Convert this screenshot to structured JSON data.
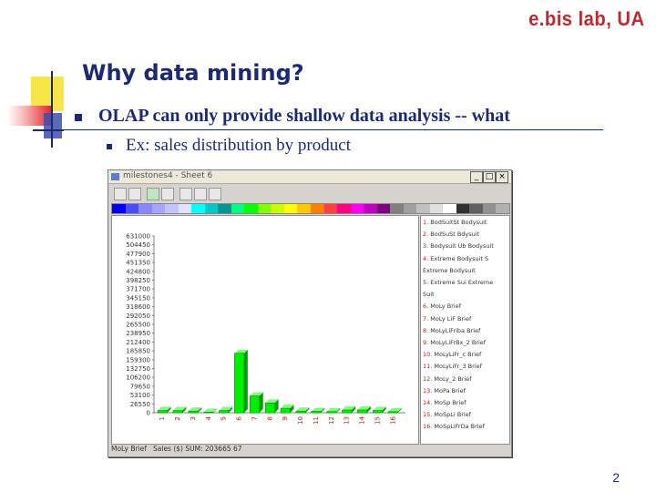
{
  "brand": "e.bis lab, UA",
  "slide_title": "Why data mining?",
  "bullet1": "OLAP can only provide shallow data analysis -- what",
  "bullet2": "Ex: sales distribution by product",
  "page_number": "2",
  "window": {
    "title": "milestones4 - Sheet 6",
    "min_label": "_",
    "max_label": "□",
    "close_label": "×",
    "toolbar_icons": [
      "open-icon",
      "save-icon",
      "chart-icon",
      "table-icon",
      "grid-icon",
      "tools-icon",
      "spell-icon"
    ],
    "status_left": "MoLy Brief",
    "status_right": "Sales ($) SUM: 203665 67"
  },
  "palette": [
    "#0000ff",
    "#4b4bff",
    "#8787ff",
    "#a5a5ff",
    "#c3c3ff",
    "#e1e1ff",
    "#00ffff",
    "#00c8c8",
    "#009696",
    "#00ff80",
    "#00ff00",
    "#80ff00",
    "#c8ff00",
    "#ffff00",
    "#ffc800",
    "#ff8000",
    "#ff4040",
    "#ff0080",
    "#ff00ff",
    "#c000c0",
    "#800080",
    "#808080",
    "#a0a0a0",
    "#c0c0c0",
    "#e0e0e0",
    "#ffffff",
    "#303030",
    "#606060",
    "#909090",
    "#b0b0b0"
  ],
  "chart_data": {
    "type": "bar",
    "categories": [
      "1",
      "2",
      "3",
      "4",
      "5",
      "6",
      "7",
      "8",
      "9",
      "10",
      "11",
      "12",
      "13",
      "14",
      "15",
      "16"
    ],
    "values": [
      8000,
      8000,
      6000,
      2000,
      8000,
      212400,
      60000,
      35000,
      16000,
      6000,
      5000,
      4000,
      10000,
      10000,
      8000,
      4000
    ],
    "y_ticks": [
      "631000",
      "504450",
      "477900",
      "451350",
      "424800",
      "398250",
      "371700",
      "345150",
      "318600",
      "292050",
      "265500",
      "238950",
      "212400",
      "185850",
      "159300",
      "132750",
      "106200",
      "79650",
      "53100",
      "26550",
      "0"
    ],
    "ylim": [
      0,
      631000
    ],
    "colors": {
      "bar_front": "#00ee00",
      "bar_side": "#009c00",
      "bar_top": "#7dff7d",
      "axis": "#808080",
      "tick_label": "#b02020"
    },
    "legend": [
      {
        "num": "1.",
        "label": "BodSuitSt Bodysuit"
      },
      {
        "num": "2.",
        "label": "BodSuSt Bdysuit"
      },
      {
        "num": "3.",
        "label": "Bodysuit Ub Bodysuit"
      },
      {
        "num": "4.",
        "label": "Extreme Bodysuit S"
      },
      {
        "num": "",
        "label": "Extreme Bodysuit"
      },
      {
        "num": "5.",
        "label": "Extreme Sui Extreme"
      },
      {
        "num": "",
        "label": "Suit"
      },
      {
        "num": "6.",
        "label": "MoLy Brief"
      },
      {
        "num": "7.",
        "label": "MoLy LiF Brief"
      },
      {
        "num": "8.",
        "label": "MoLyLiFriba Brief"
      },
      {
        "num": "9.",
        "label": "MoLyLiFrBx_2 Brief"
      },
      {
        "num": "10.",
        "label": "MoLyLiFr_c Brief"
      },
      {
        "num": "11.",
        "label": "MoLyLiFr_3 Brief"
      },
      {
        "num": "12.",
        "label": "MoLy_2 Brief"
      },
      {
        "num": "13.",
        "label": "MoPa Brief"
      },
      {
        "num": "14.",
        "label": "MoSp Brief"
      },
      {
        "num": "15.",
        "label": "MoSpLi Brief"
      },
      {
        "num": "16.",
        "label": "MoSpLiFrDa Brief"
      }
    ]
  }
}
